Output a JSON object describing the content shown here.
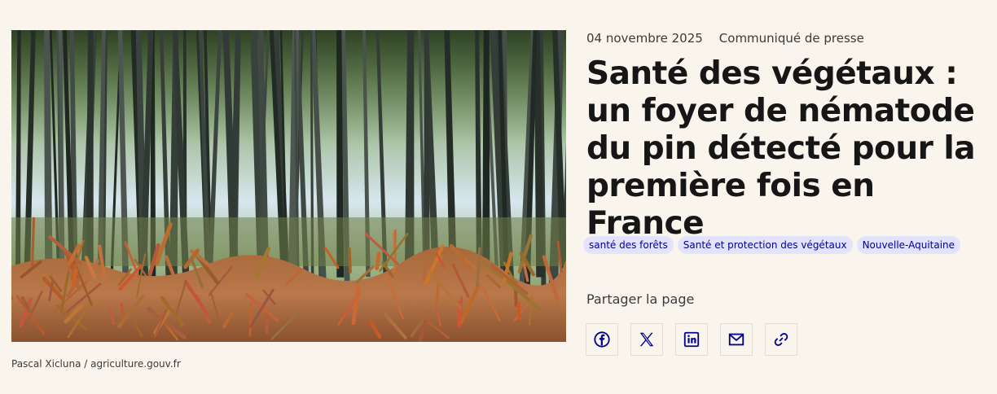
{
  "image": {
    "alt": "Forêt de pins avec fougères au premier plan",
    "credit": "Pascal Xicluna / agriculture.gouv.fr"
  },
  "meta": {
    "date": "04 novembre 2025",
    "category": "Communiqué de presse"
  },
  "title": "Santé des végétaux : un foyer de nématode du pin détecté pour la première fois en France",
  "tags": [
    {
      "label": "santé des forêts"
    },
    {
      "label": "Santé et protection des végétaux"
    },
    {
      "label": "Nouvelle-Aquitaine"
    }
  ],
  "share": {
    "label": "Partager la page",
    "buttons": [
      {
        "icon": "facebook-icon"
      },
      {
        "icon": "x-icon"
      },
      {
        "icon": "linkedin-icon"
      },
      {
        "icon": "mail-icon"
      },
      {
        "icon": "link-icon"
      }
    ]
  },
  "colors": {
    "background": "#f9f4ec",
    "accent": "#000091",
    "tag_bg": "#e3e3fd"
  }
}
